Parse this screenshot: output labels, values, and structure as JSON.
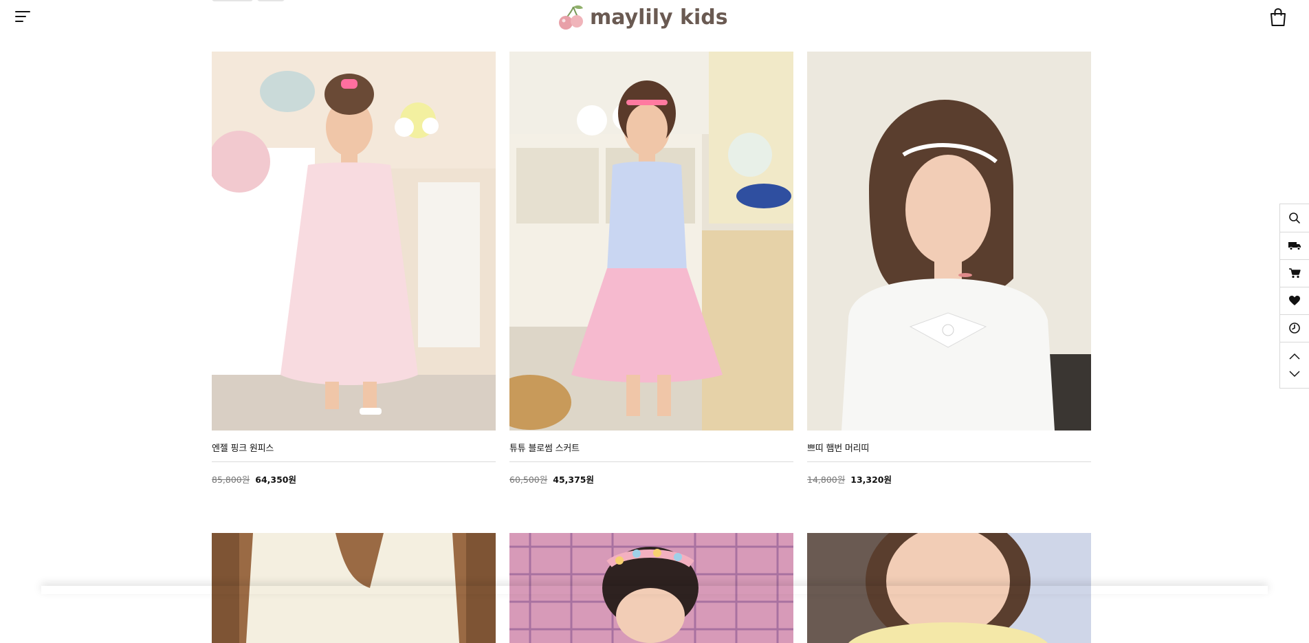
{
  "header": {
    "logo_text": "maylily kids",
    "menu_icon": "hamburger-menu-icon",
    "cart_icon": "shopping-bag-icon"
  },
  "products": [
    {
      "name": "엔젤 핑크 원피스",
      "original_price": "85,800원",
      "sale_price": "64,350원"
    },
    {
      "name": "튜튜 블로썸 스커트",
      "original_price": "60,500원",
      "sale_price": "45,375원"
    },
    {
      "name": "쁘띠 햄번 머리띠",
      "original_price": "14,800원",
      "sale_price": "13,320원"
    }
  ],
  "quick_menu": {
    "items": [
      "search-icon",
      "delivery-truck-icon",
      "cart-icon",
      "heart-icon",
      "clock-icon"
    ],
    "scroll_up": "chevron-up-icon",
    "scroll_down": "chevron-down-icon"
  },
  "colors": {
    "logo_brown": "#6a5a52",
    "cherry_pink": "#e8a0a8",
    "text": "#111111",
    "muted": "#777777"
  }
}
